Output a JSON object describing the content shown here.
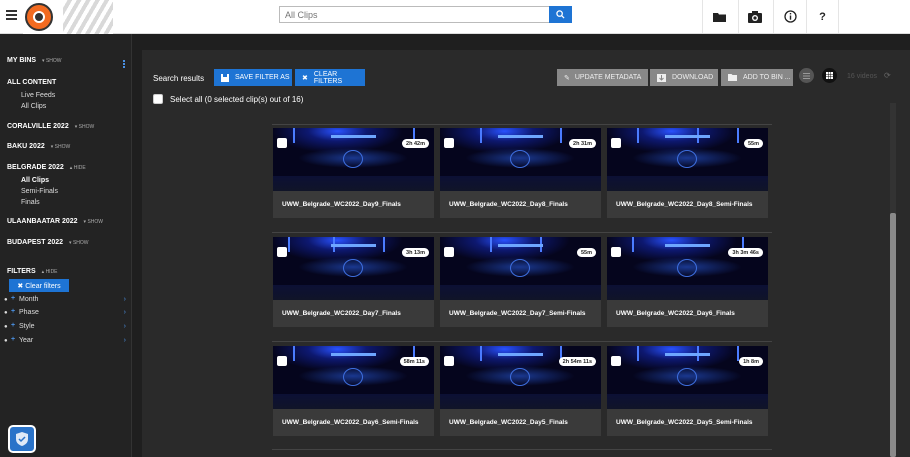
{
  "topbar": {
    "search_placeholder": "All Clips",
    "icons": [
      "menu-icon",
      "folder-icon",
      "camera-icon",
      "info-icon",
      "help-icon"
    ],
    "help_label": "?"
  },
  "sidebar": {
    "my_bins": {
      "label": "MY BINS",
      "toggle": "SHOW"
    },
    "all_content": {
      "label": "ALL CONTENT",
      "items": [
        "Live Feeds",
        "All Clips"
      ]
    },
    "bins": [
      {
        "label": "CORALVILLE 2022",
        "toggle": "SHOW"
      },
      {
        "label": "BAKU 2022",
        "toggle": "SHOW"
      },
      {
        "label": "BELGRADE 2022",
        "toggle": "HIDE",
        "items": [
          "All Clips",
          "Semi-Finals",
          "Finals"
        ]
      },
      {
        "label": "ULAANBAATAR 2022",
        "toggle": "SHOW"
      },
      {
        "label": "BUDAPEST 2022",
        "toggle": "SHOW"
      }
    ],
    "filters": {
      "label": "FILTERS",
      "toggle": "HIDE",
      "clear": "✖ Clear filters",
      "items": [
        "Month",
        "Phase",
        "Style",
        "Year"
      ]
    }
  },
  "toolbar": {
    "search_results": "Search results",
    "save_filter": "SAVE FILTER AS",
    "clear_filters": "CLEAR FILTERS",
    "update_metadata": "UPDATE METADATA",
    "download": "DOWNLOAD",
    "add_to_bin": "ADD TO BIN ...",
    "count": "16 videos",
    "select_all": "Select all (0 selected clip(s) out of 16)"
  },
  "clips": [
    {
      "title": "UWW_Belgrade_WC2022_Day9_Finals",
      "duration": "2h 42m"
    },
    {
      "title": "UWW_Belgrade_WC2022_Day8_Finals",
      "duration": "2h 31m"
    },
    {
      "title": "UWW_Belgrade_WC2022_Day8_Semi-Finals",
      "duration": "55m"
    },
    {
      "title": "UWW_Belgrade_WC2022_Day7_Finals",
      "duration": "3h 13m"
    },
    {
      "title": "UWW_Belgrade_WC2022_Day7_Semi-Finals",
      "duration": "55m"
    },
    {
      "title": "UWW_Belgrade_WC2022_Day6_Finals",
      "duration": "3h 3m 46s"
    },
    {
      "title": "UWW_Belgrade_WC2022_Day6_Semi-Finals",
      "duration": "58m 11s"
    },
    {
      "title": "UWW_Belgrade_WC2022_Day5_Finals",
      "duration": "2h 54m 11s"
    },
    {
      "title": "UWW_Belgrade_WC2022_Day5_Semi-Finals",
      "duration": "1h 8m"
    }
  ],
  "colors": {
    "accent": "#1e74d4",
    "background": "#1f1f1f",
    "logo": "#f26b21"
  }
}
